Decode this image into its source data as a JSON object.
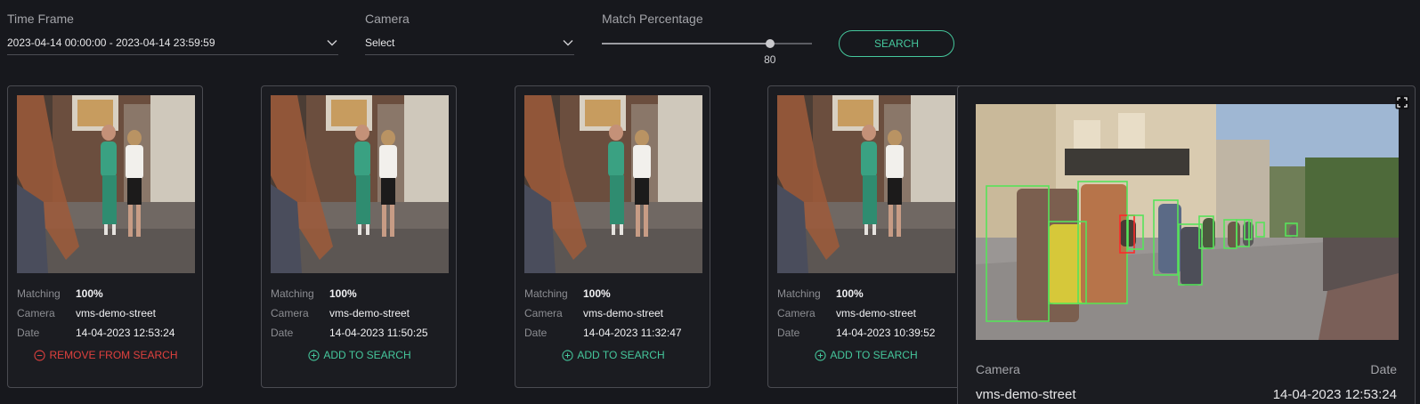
{
  "filters": {
    "time_frame": {
      "label": "Time Frame",
      "value": "2023-04-14 00:00:00 - 2023-04-14 23:59:59"
    },
    "camera": {
      "label": "Camera",
      "value": "Select"
    },
    "match": {
      "label": "Match Percentage",
      "value": 80
    },
    "search_label": "SEARCH"
  },
  "card_labels": {
    "matching": "Matching",
    "camera": "Camera",
    "date": "Date"
  },
  "results": [
    {
      "matching": "100%",
      "camera": "vms-demo-street",
      "date": "14-04-2023 12:53:24",
      "action": "REMOVE FROM SEARCH"
    },
    {
      "matching": "100%",
      "camera": "vms-demo-street",
      "date": "14-04-2023 11:50:25",
      "action": "ADD TO SEARCH"
    },
    {
      "matching": "100%",
      "camera": "vms-demo-street",
      "date": "14-04-2023 11:32:47",
      "action": "ADD TO SEARCH"
    },
    {
      "matching": "100%",
      "camera": "vms-demo-street",
      "date": "14-04-2023 10:39:52",
      "action": "ADD TO SEARCH"
    }
  ],
  "preview": {
    "camera_label": "Camera",
    "date_label": "Date",
    "camera": "vms-demo-street",
    "date": "14-04-2023 12:53:24"
  },
  "icons": {
    "dropdown": "chevron-down-icon",
    "add": "plus-circle-icon",
    "remove": "minus-circle-icon",
    "expand": "fullscreen-icon"
  },
  "colors": {
    "accent": "#45c79c",
    "danger": "#e0413e",
    "detection_box": "#57e35a",
    "selected_box": "#ff2a2a"
  }
}
